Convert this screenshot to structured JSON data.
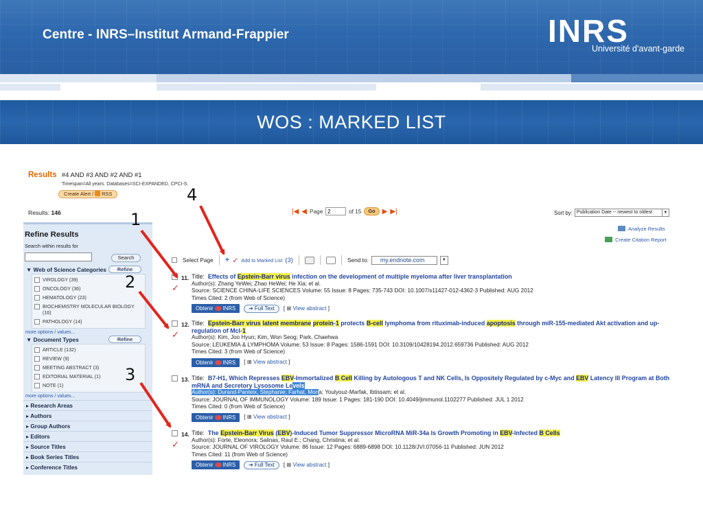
{
  "header": {
    "org_name": "Centre - INRS–Institut Armand-Frappier",
    "logo_text": "INRS",
    "logo_subtitle": "Université d'avant-garde",
    "slide_title": "WOS : MARKED LIST"
  },
  "colors": {
    "banner": "#2d67ad",
    "title_bar": "#2a66ad",
    "highlight": "#f5f04a",
    "link": "#2447a0",
    "arrow": "#e3241b"
  },
  "results": {
    "label": "Results",
    "query": "#4 AND #3 AND #2 AND #1",
    "timespan": "Timespan=All years. Databases=SCI-EXPANDED, CPCI-S.",
    "create_alert": "Create Alert /",
    "rss": "RSS",
    "count_label": "Results:",
    "count": "146",
    "page_label": "Page",
    "page_value": "2",
    "page_of": "of 15",
    "go": "Go",
    "sort_label": "Sort by:",
    "sort_value": "Publication Date -- newest to oldest"
  },
  "sidebar": {
    "title": "Refine Results",
    "search_within": "Search within results for",
    "search_button": "Search",
    "refine_button": "Refine",
    "categories_header": "Web of Science Categories",
    "categories": [
      "VIROLOGY (39)",
      "ONCOLOGY (36)",
      "HEMATOLOGY (23)",
      "BIOCHEMISTRY MOLECULAR BIOLOGY (16)",
      "PATHOLOGY (14)"
    ],
    "more_options": "more options / values...",
    "doctype_header": "Document Types",
    "doctypes": [
      "ARTICLE (132)",
      "REVIEW (9)",
      "MEETING ABSTRACT (3)",
      "EDITORIAL MATERIAL (1)",
      "NOTE (1)"
    ],
    "collapsed": [
      "Research Areas",
      "Authors",
      "Group Authors",
      "Editors",
      "Source Titles",
      "Book Series Titles",
      "Conference Titles"
    ]
  },
  "tools": {
    "analyze": "Analyze Results",
    "citation_report": "Create Citation Report",
    "select_page": "Select Page",
    "add_marked": "Add to Marked List",
    "marked_count": "(3)",
    "send_to": "Send to:",
    "send_value": "my.endnote.com"
  },
  "buttons": {
    "obtenir": "Obtenir",
    "obtenir_inrs": "INRS",
    "full_text": "Full Text",
    "view_abstract": "View abstract"
  },
  "records": [
    {
      "num": "11.",
      "title_parts": [
        "Effects of ",
        "Epstein-Barr virus",
        " infection on the development of multiple myeloma after liver transplantation"
      ],
      "authors": "Author(s): Zhang YeWei; Zhao HeWei; He Xia; et al.",
      "source": "Source: SCIENCE CHINA-LIFE SCIENCES  Volume: 55  Issue: 8  Pages: 735-743  DOI: 10.1007/s11427-012-4362-3  Published: AUG 2012",
      "cited": "Times Cited:  2  (from Web of Science)"
    },
    {
      "num": "12.",
      "title_parts": [
        "Epstein-Barr virus",
        " ",
        "latent",
        " ",
        "membrane",
        " ",
        "protein",
        "-",
        "1",
        " protects ",
        "B-cell",
        " lymphoma from rituximab-induced ",
        "apoptosis",
        " through miR-155-mediated Akt activation and up-regulation of Mcl-",
        "1"
      ],
      "authors": "Author(s): Kim, Joo Hyun; Kim, Won Seog; Park, Chaehwa",
      "source": "Source: LEUKEMIA & LYMPHOMA  Volume: 53  Issue: 8  Pages: 1586-1591  DOI: 10.3109/10428194.2012.659736  Published: AUG 2012",
      "cited": "Times Cited:  3  (from Web of Science)"
    },
    {
      "num": "13.",
      "title_parts": [
        "B7-H1, Which Represses ",
        "EBV",
        "-Immortalized ",
        "B Cell",
        " Killing by Autologous T and NK Cells, Is Oppositely Regulated by c-Myc and ",
        "EBV",
        " Latency III Program at Both mRNA and Secretory Lysosome Le",
        "vels"
      ],
      "authors_sel": "Author(s): Durand-Panteix, Stephanie; Farhat, Mon",
      "authors_rest": "a; Youlyouz-Marfak, Ibtissam; et al.",
      "source": "Source: JOURNAL OF IMMUNOLOGY  Volume: 189  Issue: 1  Pages: 181-190  DOI: 10.4049/jimmunol.1102277  Published: JUL 1 2012",
      "cited": "Times Cited:  0  (from Web of Science)"
    },
    {
      "num": "14.",
      "title_parts": [
        "The ",
        "Epstein-Barr Virus",
        " (",
        "EBV",
        ")-Induced Tumor Suppressor MicroRNA MiR-34a Is Growth Promoting in ",
        "EBV",
        "-Infected ",
        "B Cells"
      ],
      "authors": "Author(s): Forte, Eleonora; Salinas, Raul E.; Chang, Christina; et al.",
      "source": "Source: JOURNAL OF VIROLOGY  Volume: 86  Issue: 12  Pages: 6889-6898  DOI: 10.1128/JVI.07056-11  Published: JUN 2012",
      "cited": "Times Cited:  11  (from Web of Science)"
    }
  ],
  "annotations": [
    "1",
    "2",
    "3",
    "4"
  ]
}
